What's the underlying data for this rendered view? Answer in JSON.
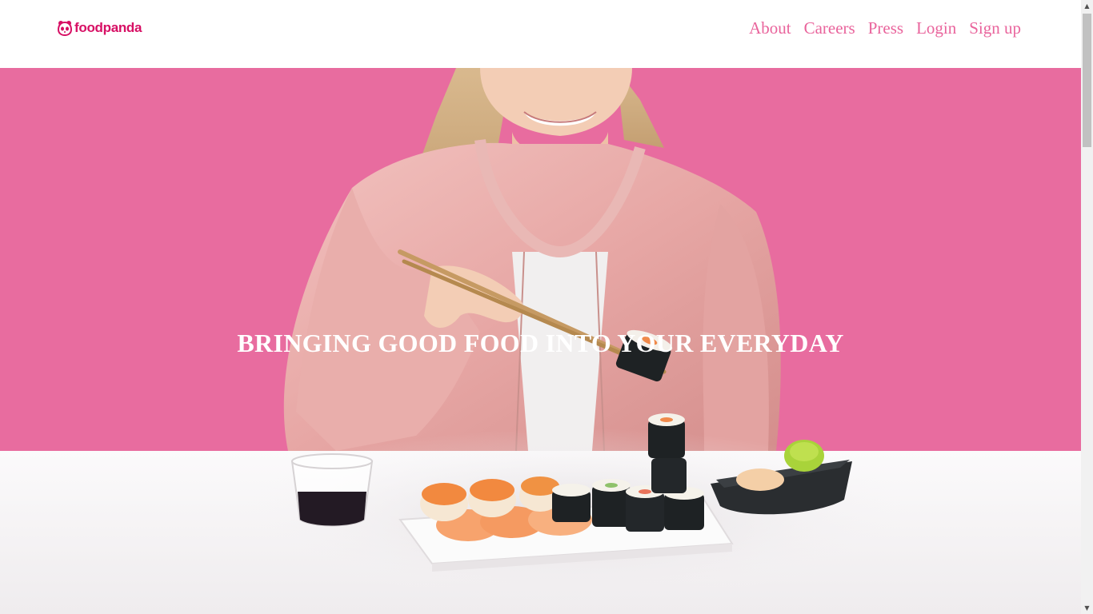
{
  "header": {
    "logo": {
      "text": "foodpanda",
      "icon": "panda-icon",
      "color": "#d70f64"
    },
    "nav": [
      {
        "label": "About"
      },
      {
        "label": "Careers"
      },
      {
        "label": "Press"
      },
      {
        "label": "Login"
      },
      {
        "label": "Sign up"
      }
    ],
    "nav_color": "#e9649c"
  },
  "hero": {
    "title": "BRINGING GOOD FOOD INTO YOUR EVERYDAY",
    "background_color": "#e86c9f"
  },
  "scrollbar": {
    "up_icon": "arrow-up-icon",
    "down_icon": "arrow-down-icon"
  }
}
